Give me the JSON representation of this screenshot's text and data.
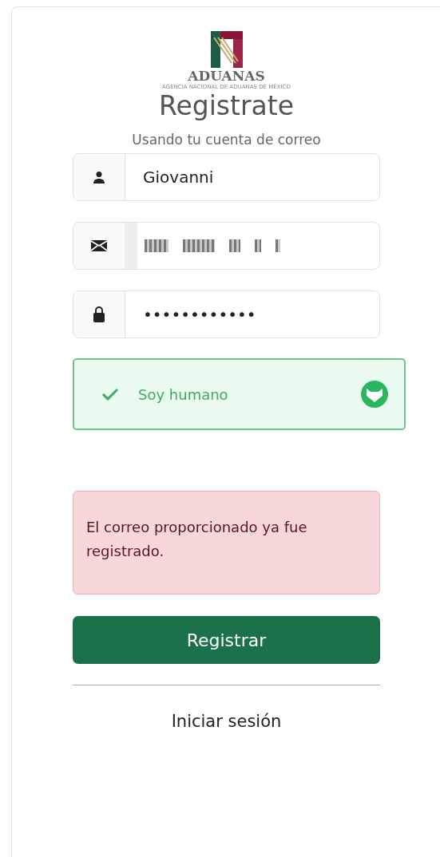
{
  "logo": {
    "name": "ADUANAS",
    "subtitle": "AGENCIA NACIONAL DE ADUANAS DE MÉXICO"
  },
  "title": "Registrate",
  "subtitle": "Usando tu cuenta de correo",
  "fields": [
    {
      "kind": "name",
      "value": "Giovanni"
    },
    {
      "kind": "email",
      "redacted": true
    },
    {
      "kind": "password",
      "value": "••••••••••••"
    }
  ],
  "captcha": {
    "label": "Soy humano",
    "verified": true
  },
  "alert": {
    "message": "El correo proporcionado ya fue registrado."
  },
  "submit": "Registrar",
  "login_link": "Iniciar sesión"
}
